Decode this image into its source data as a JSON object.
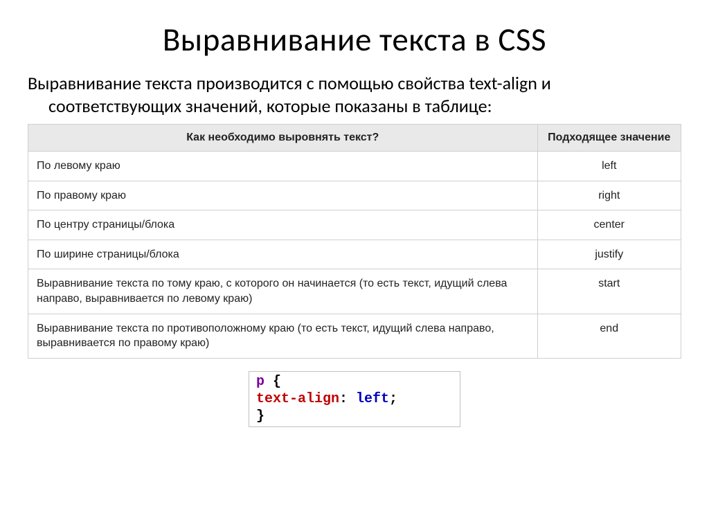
{
  "title": "Выравнивание текста в CSS",
  "intro": "Выравнивание текста производится с помощью свойства text-align и соответствующих значений, которые показаны в таблице:",
  "table": {
    "header_desc": "Как необходимо выровнять текст?",
    "header_val": "Подходящее значение",
    "rows": [
      {
        "desc": "По левому краю",
        "val": "left"
      },
      {
        "desc": "По правому краю",
        "val": "right"
      },
      {
        "desc": "По центру страницы/блока",
        "val": "center"
      },
      {
        "desc": "По ширине страницы/блока",
        "val": "justify"
      },
      {
        "desc": "Выравнивание текста по тому краю, с которого он начинается (то есть текст, идущий слева направо, выравнивается по левому краю)",
        "val": "start"
      },
      {
        "desc": "Выравнивание текста по противоположному краю (то есть текст, идущий слева направо, выравнивается по правому краю)",
        "val": "end"
      }
    ]
  },
  "code": {
    "selector": "p",
    "open": " {",
    "property": "text-align",
    "colon": ": ",
    "value": "left",
    "semicolon": ";",
    "close": "}"
  }
}
